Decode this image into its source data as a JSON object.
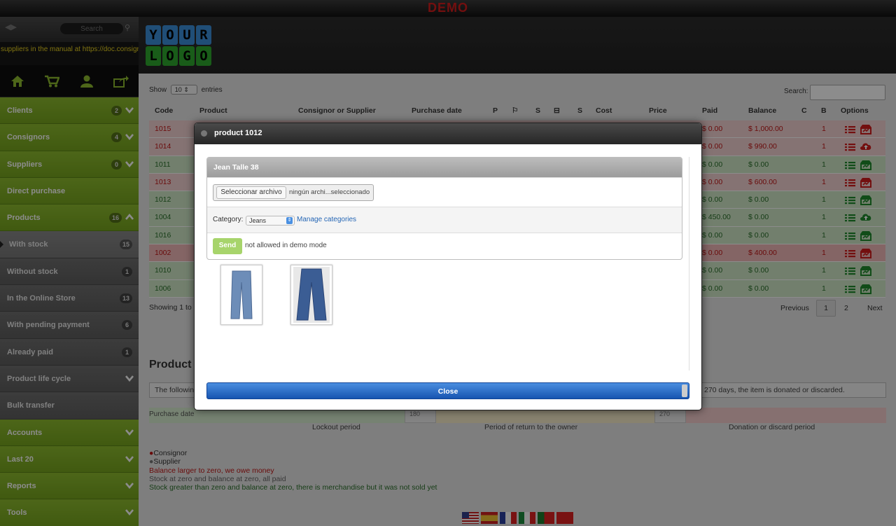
{
  "banner": "DEMO",
  "sidebar": {
    "search_placeholder": "Search",
    "marquee": "suppliers in the manual at https://doc.consign",
    "items": [
      {
        "label": "Clients",
        "count": "2"
      },
      {
        "label": "Consignors",
        "count": "4"
      },
      {
        "label": "Suppliers",
        "count": "0"
      },
      {
        "label": "Direct purchase"
      },
      {
        "label": "Products",
        "count": "16"
      },
      {
        "label": "With stock",
        "count": "15"
      },
      {
        "label": "Without stock",
        "count": "1"
      },
      {
        "label": "In the Online Store",
        "count": "13"
      },
      {
        "label": "With pending payment",
        "count": "6"
      },
      {
        "label": "Already paid",
        "count": "1"
      },
      {
        "label": "Product life cycle"
      },
      {
        "label": "Bulk transfer"
      },
      {
        "label": "Accounts"
      },
      {
        "label": "Last 20"
      },
      {
        "label": "Reports"
      },
      {
        "label": "Tools"
      }
    ]
  },
  "logo": [
    "Y",
    "O",
    "U",
    "R",
    "L",
    "O",
    "G",
    "O"
  ],
  "table": {
    "show_label": "Show",
    "entries_value": "10",
    "entries_label": "entries",
    "search_label": "Search:",
    "columns": [
      "Code",
      "Product",
      "Consignor or Supplier",
      "Purchase date",
      "P",
      "S",
      "S",
      "Cost",
      "Price",
      "Paid",
      "Balance",
      "C",
      "B",
      "Options"
    ],
    "rows": [
      {
        "code": "1015",
        "paid": "$ 0.00",
        "balance": "$ 1,000.00",
        "c": "1",
        "status": "red"
      },
      {
        "code": "1014",
        "paid": "$ 0.00",
        "balance": "$ 990.00",
        "c": "1",
        "status": "red"
      },
      {
        "code": "1011",
        "paid": "$ 0.00",
        "balance": "$ 0.00",
        "c": "1",
        "status": "green"
      },
      {
        "code": "1013",
        "paid": "$ 0.00",
        "balance": "$ 600.00",
        "c": "1",
        "status": "red"
      },
      {
        "code": "1012",
        "paid": "$ 0.00",
        "balance": "$ 0.00",
        "c": "1",
        "status": "green"
      },
      {
        "code": "1004",
        "paid": "$ 450.00",
        "balance": "$ 0.00",
        "c": "1",
        "status": "green"
      },
      {
        "code": "1016",
        "paid": "$ 0.00",
        "balance": "$ 0.00",
        "c": "1",
        "status": "green"
      },
      {
        "code": "1002",
        "paid": "$ 0.00",
        "balance": "$ 400.00",
        "c": "1",
        "status": "red-strong"
      },
      {
        "code": "1010",
        "paid": "$ 0.00",
        "balance": "$ 0.00",
        "c": "1",
        "status": "green"
      },
      {
        "code": "1006",
        "paid": "$ 0.00",
        "balance": "$ 0.00",
        "c": "1",
        "status": "green"
      }
    ],
    "showing": "Showing 1 to",
    "pager": {
      "prev": "Previous",
      "page1": "1",
      "page2": "2",
      "next": "Next"
    }
  },
  "lifecycle": {
    "title": "Product",
    "bar_left": "The followin",
    "bar_right": "270 days, the item is donated or discarded.",
    "purchase_label": "Purchase date",
    "v180": "180",
    "v270": "270",
    "lockout": "Lockout period",
    "return": "Period of return to the owner",
    "donation": "Donation or discard period"
  },
  "legend": {
    "consignor": "Consignor",
    "supplier": "Supplier",
    "line1": "Balance larger to zero, we owe money",
    "line2": "Stock at zero and balance at zero, all paid",
    "line3": "Stock greater than zero and balance at zero, there is merchandise but it was not sold yet"
  },
  "modal": {
    "title": "product 1012",
    "inner_title": "Jean Talle 38",
    "file_button": "Seleccionar archivo",
    "file_status": "ningún archi...seleccionado",
    "category_label": "Category:",
    "category_value": "Jeans",
    "manage_link": "Manage categories",
    "send": "Send",
    "demo_note": "not allowed in demo mode",
    "close": "Close"
  },
  "colors": {
    "green_nav": "#8cba2e",
    "red_text": "#c01616",
    "green_text": "#2a6f2a",
    "close_blue": "#1754b0"
  }
}
